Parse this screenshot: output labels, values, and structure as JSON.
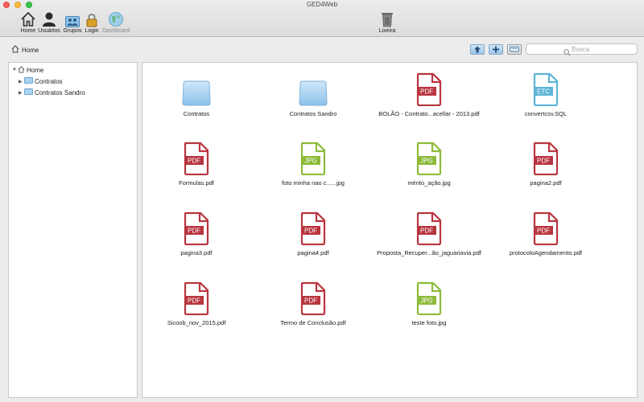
{
  "window": {
    "title": "GED4Web"
  },
  "toolbar": {
    "items": [
      {
        "label": "Home",
        "icon": "home-icon"
      },
      {
        "label": "Usuários",
        "icon": "user-icon"
      },
      {
        "label": "Grupos",
        "icon": "group-icon"
      },
      {
        "label": "Login",
        "icon": "lock-icon"
      },
      {
        "label": "Dashboard",
        "icon": "globe-icon",
        "disabled": true
      }
    ],
    "trash": {
      "label": "Lixeira",
      "icon": "trash-icon"
    }
  },
  "breadcrumb": {
    "label": "Home",
    "icon": "home-icon"
  },
  "view_buttons": [
    {
      "icon": "upload-icon"
    },
    {
      "icon": "add-icon"
    },
    {
      "icon": "scan-icon"
    }
  ],
  "search": {
    "placeholder": "Busca",
    "value": ""
  },
  "tree": {
    "root": "Home",
    "children": [
      {
        "label": "Contratos"
      },
      {
        "label": "Contratos Sandro"
      }
    ]
  },
  "files": [
    {
      "name": "Contratos",
      "type": "folder"
    },
    {
      "name": "Contratos Sandro",
      "type": "folder"
    },
    {
      "name": "BOLÃO - Contrato...acellar - 2013.pdf",
      "type": "PDF"
    },
    {
      "name": "convertcsv.SQL",
      "type": "ETC"
    },
    {
      "name": "Formulas.pdf",
      "type": "PDF"
    },
    {
      "name": "foto minha nao c......jpg",
      "type": "JPG"
    },
    {
      "name": "mérito_ação.jpg",
      "type": "JPG"
    },
    {
      "name": "pagina2.pdf",
      "type": "PDF"
    },
    {
      "name": "pagina3.pdf",
      "type": "PDF"
    },
    {
      "name": "pagina4.pdf",
      "type": "PDF"
    },
    {
      "name": "Proposta_Recuper...ão_jaguariavia.pdf",
      "type": "PDF"
    },
    {
      "name": "protocoloAgendamento.pdf",
      "type": "PDF"
    },
    {
      "name": "Sicoob_nov_2015.pdf",
      "type": "PDF"
    },
    {
      "name": "Termo de Conclusão.pdf",
      "type": "PDF"
    },
    {
      "name": "teste foto.jpg",
      "type": "JPG"
    }
  ],
  "colors": {
    "pdf": "#b8353f",
    "jpg": "#8dbb3a",
    "etc": "#5db4d6",
    "folder": "#8fc3ea"
  }
}
